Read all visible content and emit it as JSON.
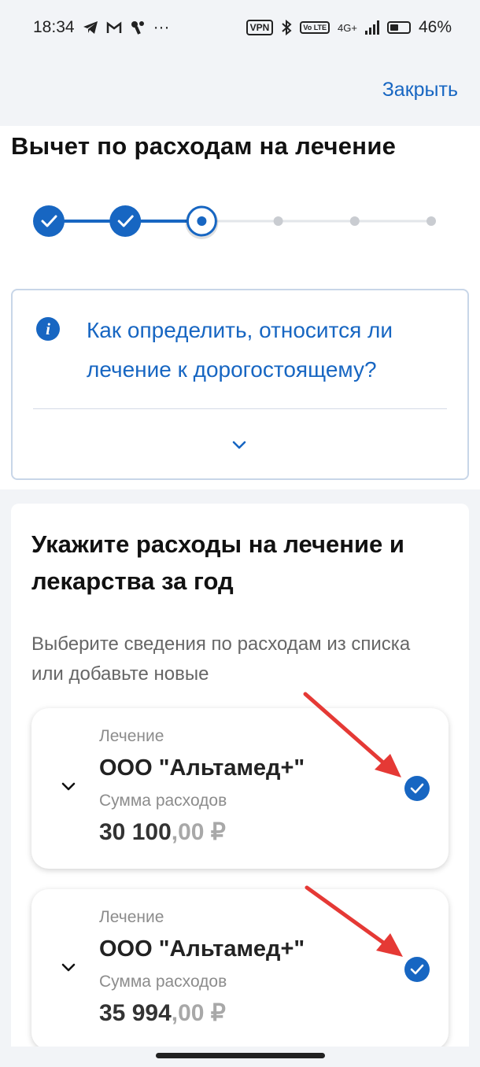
{
  "status_bar": {
    "time": "18:34",
    "left_icons": [
      "telegram-icon",
      "gmail-icon",
      "app-icon",
      "more-icon"
    ],
    "more": "···",
    "vpn": "VPN",
    "volte": "Vo LTE",
    "network": "4G+",
    "battery_level": 0.46,
    "battery_text": "46%"
  },
  "header": {
    "close_label": "Закрыть"
  },
  "page": {
    "title": "Вычет по расходам на лечение"
  },
  "stepper": {
    "total_steps": 6,
    "current_step": 3,
    "completed_steps": 2,
    "accent_color": "#1766c2"
  },
  "info": {
    "icon": "info-icon",
    "icon_glyph": "i",
    "text": "Как определить, относится ли лечение к дорогостоящему?"
  },
  "form": {
    "title": "Укажите расходы на лечение и лекарства за год",
    "subtitle": "Выберите сведения по расходам из списка или добавьте новые",
    "expenses": [
      {
        "type_label": "Лечение",
        "name": "ООО \"Альтамед+\"",
        "amount_label": "Сумма расходов",
        "amount_int": "30 100",
        "amount_dec": ",00 ₽",
        "selected": true
      },
      {
        "type_label": "Лечение",
        "name": "ООО \"Альтамед+\"",
        "amount_label": "Сумма расходов",
        "amount_int": "35 994",
        "amount_dec": ",00 ₽",
        "selected": true
      }
    ]
  },
  "annotation_color": "#e53935"
}
